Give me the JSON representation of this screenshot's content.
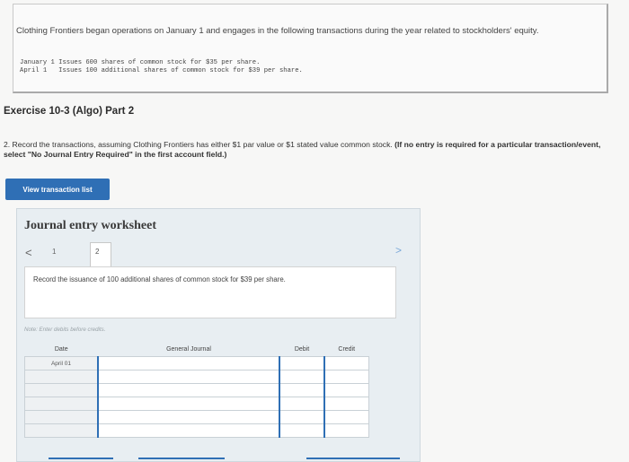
{
  "intro": "Clothing Frontiers began operations on January 1 and engages in the following transactions during the year related to stockholders' equity.",
  "transactions": [
    "January 1 Issues 600 shares of common stock for $35 per share.",
    "April 1   Issues 100 additional shares of common stock for $39 per share."
  ],
  "exercise_title": "Exercise 10-3 (Algo) Part 2",
  "question": "2. Record the transactions, assuming Clothing Frontiers has either $1 par value or $1 stated value common stock.",
  "question_bold": "(If no entry is required for a particular transaction/event, select \"No Journal Entry Required\" in the first account field.)",
  "view_button": "View transaction list",
  "worksheet": {
    "title": "Journal entry worksheet",
    "prev": "<",
    "next": ">",
    "tab1": "1",
    "tab2": "2",
    "record_text": "Record the issuance of 100 additional shares of common stock for $39 per share.",
    "note": "Note: Enter debits before credits."
  },
  "table": {
    "headers": {
      "date": "Date",
      "journal": "General Journal",
      "debit": "Debit",
      "credit": "Credit"
    },
    "first_date": "April 01"
  },
  "colors": {
    "accent": "#2f6fb5",
    "panel": "#e8eef2"
  }
}
